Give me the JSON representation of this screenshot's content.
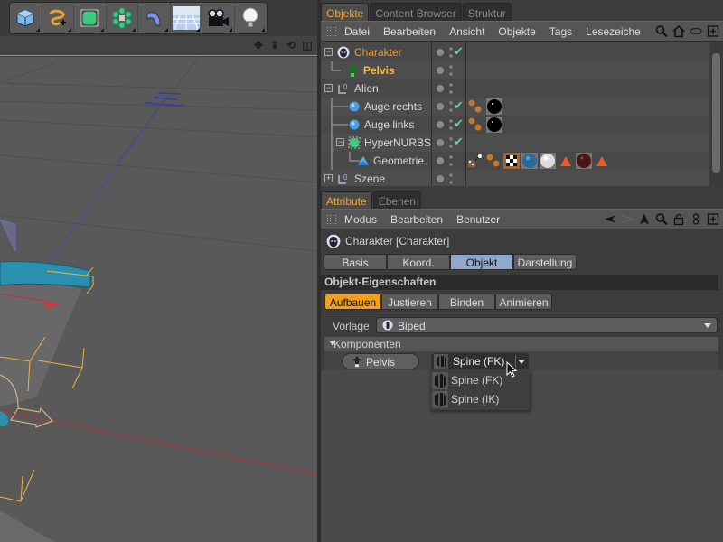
{
  "toolbar": {
    "tools": [
      {
        "name": "cube-tool",
        "icon": "cube-icon"
      },
      {
        "name": "spline-tool",
        "icon": "spline-pen-icon"
      },
      {
        "name": "nurbs-tool",
        "icon": "hypernurbs-icon"
      },
      {
        "name": "array-tool",
        "icon": "array-icon"
      },
      {
        "name": "deformer-tool",
        "icon": "bend-deformer-icon"
      },
      {
        "name": "scene-tool",
        "icon": "floor-icon"
      },
      {
        "name": "camera-tool",
        "icon": "camera-icon"
      },
      {
        "name": "light-tool",
        "icon": "light-bulb-icon"
      }
    ]
  },
  "viewport": {
    "nav_icons": [
      "move-icon",
      "zoom-icon",
      "rotate-icon",
      "layout-icon"
    ],
    "nav_glyphs": [
      "✥",
      "⇕",
      "⟲",
      "◫"
    ]
  },
  "object_manager": {
    "tabs": [
      {
        "label": "Objekte",
        "active": true
      },
      {
        "label": "Content Browser",
        "active": false
      },
      {
        "label": "Struktur",
        "active": false
      }
    ],
    "menu": [
      "Datei",
      "Bearbeiten",
      "Ansicht",
      "Objekte",
      "Tags",
      "Lesezeichen"
    ],
    "menu_icons": [
      "search-icon",
      "home-icon",
      "link-icon",
      "new-panel-icon"
    ],
    "objects": [
      {
        "name": "Charakter",
        "style": "orange",
        "indent": 0,
        "expander": "−",
        "icon": "alien-head-icon",
        "check": true,
        "tags": []
      },
      {
        "name": "Pelvis",
        "style": "bold-orange",
        "indent": 1,
        "expander": "",
        "icon": "joint-figure-icon",
        "check": false,
        "tags": []
      },
      {
        "name": "Alien",
        "style": "normal",
        "indent": 0,
        "expander": "−",
        "icon": "null-object-icon",
        "check": false,
        "tags": []
      },
      {
        "name": "Auge rechts",
        "style": "normal",
        "indent": 1,
        "expander": "",
        "icon": "sphere-icon",
        "check": true,
        "tags": [
          "phong-tag",
          "material-black"
        ]
      },
      {
        "name": "Auge links",
        "style": "normal",
        "indent": 1,
        "expander": "",
        "icon": "sphere-icon",
        "check": true,
        "tags": [
          "phong-tag",
          "material-black"
        ]
      },
      {
        "name": "HyperNURBS",
        "style": "normal",
        "indent": 1,
        "expander": "−",
        "icon": "hypernurbs-icon",
        "check": true,
        "tags": []
      },
      {
        "name": "Geometrie",
        "style": "normal",
        "indent": 2,
        "expander": "",
        "icon": "polygon-icon",
        "check": false,
        "tags": [
          "uvw-tag",
          "phong-tag",
          "texture-checker",
          "material-blue",
          "material-white",
          "selection-tag",
          "material-darkred",
          "selection-tag"
        ]
      },
      {
        "name": "Szene",
        "style": "normal",
        "indent": 0,
        "expander": "+",
        "icon": "null-object-icon",
        "check": false,
        "tags": []
      }
    ]
  },
  "attribute_manager": {
    "tabs": [
      {
        "label": "Attribute",
        "active": true
      },
      {
        "label": "Ebenen",
        "active": false
      }
    ],
    "menu": [
      "Modus",
      "Bearbeiten",
      "Benutzer"
    ],
    "menu_icons": [
      "back-arrow-icon",
      "forward-arrow-icon",
      "up-arrow-icon",
      "search-icon",
      "lock-icon",
      "link-icon",
      "new-panel-icon"
    ],
    "object_title": "Charakter [Charakter]",
    "object_tabs": [
      {
        "label": "Basis",
        "active": false
      },
      {
        "label": "Koord.",
        "active": false
      },
      {
        "label": "Objekt",
        "active": true
      },
      {
        "label": "Darstellung",
        "active": false
      }
    ],
    "section_title": "Objekt-Eigenschaften",
    "sub_tabs": [
      {
        "label": "Aufbauen",
        "active": true
      },
      {
        "label": "Justieren",
        "active": false
      },
      {
        "label": "Binden",
        "active": false
      },
      {
        "label": "Animieren",
        "active": false
      }
    ],
    "vorlage": {
      "label": "Vorlage",
      "value": "Biped"
    },
    "komponenten_label": "Komponenten",
    "pelvis_button": "Pelvis",
    "spine_select": {
      "value": "Spine (FK)",
      "options": [
        "Spine (FK)",
        "Spine (IK)"
      ]
    }
  },
  "colors": {
    "accent_orange": "#f0a020",
    "active_tab_blue": "#8fa8cc",
    "check_green": "#5fd0a0",
    "axis_blue": "#4848a8",
    "axis_red": "#c03030",
    "selection_yellow": "#f0b040",
    "mesh_teal": "#2a90b0"
  }
}
